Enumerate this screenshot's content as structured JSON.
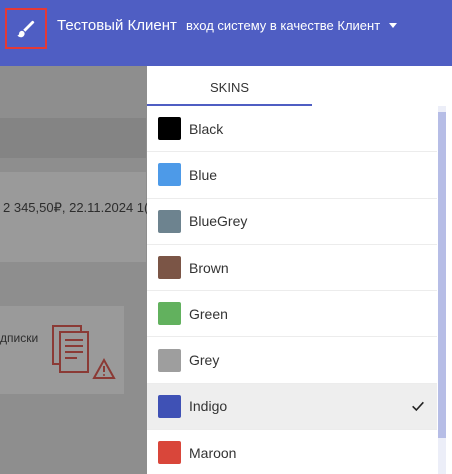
{
  "header": {
    "client_name": "Тестовый Клиент",
    "login_as": "вход систему в качестве Клиент",
    "icons": [
      "brush-icon",
      "caret-down-icon"
    ],
    "accent_color": "#4f5ec3"
  },
  "background": {
    "row_text": "2 345,50₽, 22.11.2024 1(",
    "card_text": "дписки",
    "icons": [
      "document-warning-icon"
    ]
  },
  "skins_panel": {
    "tab_label": "SKINS",
    "selected": "Indigo",
    "items": [
      {
        "label": "Black",
        "color": "#000000"
      },
      {
        "label": "Blue",
        "color": "#4d9ae8"
      },
      {
        "label": "BlueGrey",
        "color": "#6d838f"
      },
      {
        "label": "Brown",
        "color": "#7b5546"
      },
      {
        "label": "Green",
        "color": "#62b15e"
      },
      {
        "label": "Grey",
        "color": "#9e9e9e"
      },
      {
        "label": "Indigo",
        "color": "#3f51b5"
      },
      {
        "label": "Maroon",
        "color": "#d9463a"
      }
    ]
  }
}
